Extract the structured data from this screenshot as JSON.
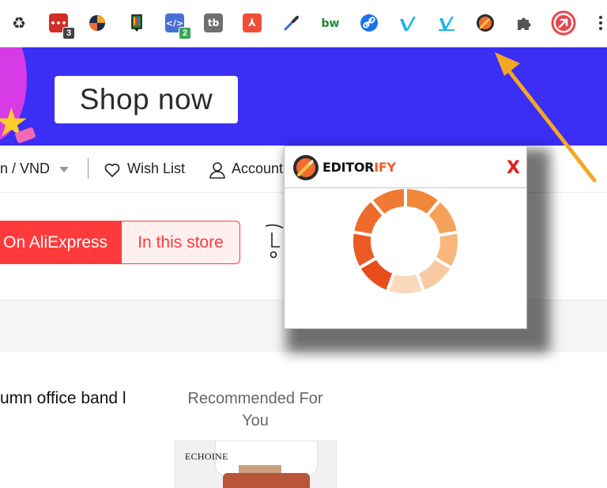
{
  "toolbar": {
    "extensions": [
      {
        "name": "recycle-extension-icon",
        "glyph": "♻",
        "color": "#2b2b2b",
        "text_color": "#2b2b2b"
      },
      {
        "name": "lastpass-extension-icon",
        "glyph": "•••",
        "color": "#d32d27",
        "badge": "3",
        "badge_style": "dark"
      },
      {
        "name": "swirl-extension-icon",
        "glyph": "",
        "color": "#f5a623"
      },
      {
        "name": "marker-extension-icon",
        "glyph": "",
        "color": "#2d7d32"
      },
      {
        "name": "code-extension-icon",
        "glyph": "</>",
        "color": "#4a6fd6",
        "badge": "2",
        "badge_style": "green"
      },
      {
        "name": "tb-extension-icon",
        "glyph": "tb",
        "color": "#6f6f6f"
      },
      {
        "name": "extension-red-square-icon",
        "glyph": "⅄",
        "color": "#f04e37"
      },
      {
        "name": "color-picker-extension-icon",
        "glyph": "",
        "color": "#2f6fd8"
      },
      {
        "name": "bw-extension-icon",
        "glyph": "bw",
        "color": "#ffffff",
        "text_color": "#1e8a2f"
      },
      {
        "name": "link-extension-icon",
        "glyph": "",
        "color": "#1a73e8"
      },
      {
        "name": "vimeo-extension-icon",
        "glyph": "V",
        "color": "#ffffff",
        "text_color": "#1ab7ea"
      },
      {
        "name": "vimeo-record-extension-icon",
        "glyph": "V",
        "color": "#ffffff",
        "text_color": "#1ab7ea"
      },
      {
        "name": "editorify-extension-icon",
        "glyph": "",
        "color": "#f26a2e"
      },
      {
        "name": "extensions-puzzle-icon",
        "glyph": "",
        "color": "#555555"
      },
      {
        "name": "red-arrow-extension-icon",
        "glyph": "",
        "color": "#e8474f"
      },
      {
        "name": "chrome-menu-icon",
        "glyph": "⋮",
        "color": "#333333"
      }
    ]
  },
  "banner": {
    "shop_now": "Shop now",
    "background": "#3b2ef5"
  },
  "nav": {
    "currency": "n / VND",
    "wish_list": "Wish List",
    "account": "Account"
  },
  "search_scope": {
    "on_aliexpress": "On AliExpress",
    "in_this_store": "In this store",
    "accent": "#ff3a3a"
  },
  "product": {
    "title_fragment": "umn office band l"
  },
  "recommended": {
    "title_line1": "Recommended For",
    "title_line2": "You",
    "card_brand": "ECHOINE"
  },
  "popup": {
    "brand_prefix": "EDITOR",
    "brand_suffix": "IFY",
    "close_label": "X",
    "accent": "#f05a28",
    "spinner_segments": [
      "#f0883a",
      "#f4a15a",
      "#f7b77d",
      "#f9c9a1",
      "#fbd9bd",
      "#e84e1b",
      "#ec5a24",
      "#ee6b2b",
      "#f07a33"
    ]
  },
  "annotation": {
    "arrow_color": "#f5a623"
  }
}
